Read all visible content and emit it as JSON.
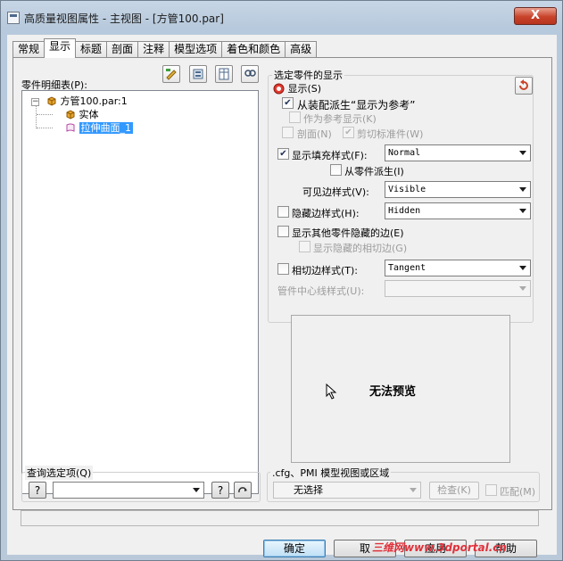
{
  "window": {
    "title": "高质量视图属性 - 主视图 - [方管100.par]",
    "close_label": "X"
  },
  "tabs": [
    "常规",
    "显示",
    "标题",
    "剖面",
    "注释",
    "模型选项",
    "着色和颜色",
    "高级"
  ],
  "active_tab": "显示",
  "parts_list": {
    "label": "零件明细表(P):",
    "items": [
      {
        "label": "方管100.par:1",
        "icon": "part-cube-icon"
      },
      {
        "label": "实体",
        "icon": "solid-cube-icon"
      },
      {
        "label": "拉伸曲面_1",
        "icon": "surface-icon",
        "selected": true
      }
    ]
  },
  "toolbar_icons": [
    "edit-icon",
    "assembly-icon",
    "columns-icon",
    "find-icon"
  ],
  "selected_display": {
    "group_title": "选定零件的显示",
    "display_label": "显示(S)",
    "derive_checkbox": {
      "label": "从装配派生“显示为参考”",
      "checked": true
    },
    "as_reference": {
      "label": "作为参考显示(K)",
      "checked": false
    },
    "section": {
      "label": "剖面(N)",
      "checked": false
    },
    "clip_standard": {
      "label": "剪切标准件(W)",
      "checked": true
    },
    "fill_style": {
      "label": "显示填充样式(F):",
      "checked": true,
      "value": "Normal"
    },
    "from_part": {
      "label": "从零件派生(I)",
      "checked": false
    },
    "visible_edge": {
      "label": "可见边样式(V):",
      "value": "Visible"
    },
    "hidden_edge": {
      "label": "隐藏边样式(H):",
      "checked": false,
      "value": "Hidden"
    },
    "show_other_hidden": {
      "label": "显示其他零件隐藏的边(E)",
      "checked": false
    },
    "show_hidden_tangent": {
      "label": "显示隐藏的相切边(G)",
      "checked": false
    },
    "tangent_edge": {
      "label": "相切边样式(T):",
      "checked": false,
      "value": "Tangent"
    },
    "pipe_centerline": {
      "label": "管件中心线样式(U):",
      "value": ""
    }
  },
  "preview": {
    "text": "无法预览"
  },
  "query": {
    "group_title": "查询选定项(Q)",
    "help_label": "?",
    "value": ""
  },
  "cfg": {
    "group_title": ".cfg、PMI 模型视图或区域",
    "value": "无选择",
    "check_button": "检查(K)",
    "match_label": "匹配(M)"
  },
  "buttons": {
    "ok": "确定",
    "cancel": "取",
    "apply": "应用",
    "help": "帮助"
  },
  "watermark": "三维网www.3dportal.cn",
  "colors": {
    "accent": "#3399ff",
    "close": "#c8432a",
    "watermark": "#e0313b"
  }
}
